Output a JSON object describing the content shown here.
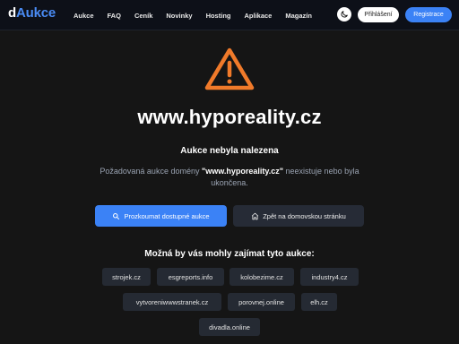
{
  "header": {
    "logo_d": "d",
    "logo_rest": "Aukce",
    "nav": [
      "Aukce",
      "FAQ",
      "Ceník",
      "Novinky",
      "Hosting",
      "Aplikace",
      "Magazín"
    ],
    "theme_icon": "moon-icon",
    "login_label": "Přihlášení",
    "register_label": "Registrace"
  },
  "main": {
    "warning_icon": "warning-triangle-icon",
    "domain": "www.hyporeality.cz",
    "status": "Aukce nebyla nalezena",
    "desc_before": "Požadovaná aukce domény ",
    "desc_domain": "\"www.hyporeality.cz\"",
    "desc_after": " neexistuje nebo byla ukončena.",
    "explore_label": "Prozkoumat dostupné aukce",
    "explore_icon": "search-icon",
    "home_label": "Zpět na domovskou stránku",
    "home_icon": "home-icon"
  },
  "related": {
    "title": "Možná by vás mohly zajímat tyto aukce:",
    "items": [
      "strojek.cz",
      "esgreports.info",
      "kolobezime.cz",
      "industry4.cz",
      "vytvoreniwwwstranek.cz",
      "porovnej.online",
      "elh.cz",
      "divadla.online"
    ]
  },
  "colors": {
    "accent": "#3b82f6",
    "warning": "#f07a2a",
    "background": "#151515"
  }
}
